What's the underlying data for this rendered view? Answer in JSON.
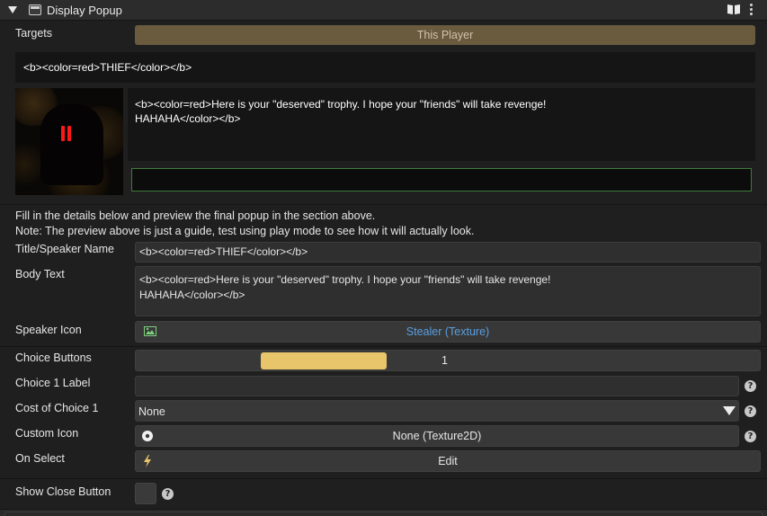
{
  "header": {
    "title": "Display Popup",
    "icons": [
      "collapse-caret-icon",
      "panel-icon",
      "book-icon",
      "kebab-menu-icon"
    ]
  },
  "targets": {
    "label": "Targets",
    "button_label": "This Player"
  },
  "preview": {
    "title": "<b><color=red>THIEF</color></b>",
    "body": "<b><color=red>Here is your \"deserved\" trophy. I hope your \"friends\" will take revenge!\nHAHAHA</color></b>",
    "choice_value": ""
  },
  "info": {
    "line1": "Fill in the details below and preview the final popup in the section above.",
    "line2": "Note: The preview above is just a guide, test using play mode to see how it will actually look."
  },
  "fields": {
    "title_label": "Title/Speaker Name",
    "title_value": "<b><color=red>THIEF</color></b>",
    "body_label": "Body Text",
    "body_value": "<b><color=red>Here is your \"deserved\" trophy. I hope your \"friends\" will take revenge!\nHAHAHA</color></b>",
    "speaker_icon_label": "Speaker Icon",
    "speaker_icon_value": "Stealer (Texture)",
    "choice_buttons_label": "Choice Buttons",
    "choice_buttons_value": "1",
    "choice_buttons_fraction": 0.2,
    "choice1_label_label": "Choice 1 Label",
    "choice1_label_value": "",
    "cost_label": "Cost of Choice 1",
    "cost_value": "None",
    "custom_icon_label": "Custom Icon",
    "custom_icon_value": "None (Texture2D)",
    "on_select_label": "On Select",
    "on_select_value": "Edit",
    "show_close_label": "Show Close Button",
    "show_close_checked": false
  },
  "colors": {
    "accent_yellow": "#e8c56a",
    "link_blue": "#5a9fe0",
    "preview_red": "#ff1818",
    "choice_border_green": "#3f7a3a",
    "targets_button": "#6a5a3e"
  }
}
